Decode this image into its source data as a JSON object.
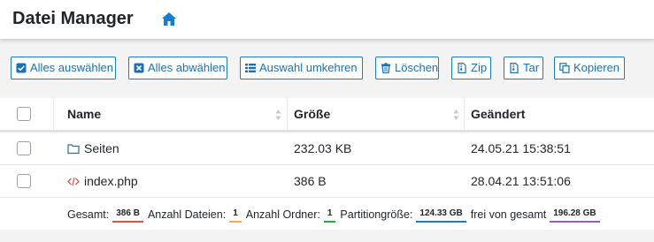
{
  "header": {
    "title": "Datei Manager",
    "home_icon": "home-icon"
  },
  "toolbar": {
    "buttons": [
      {
        "label": "Alles auswählen",
        "icon": "checkbox-checked-icon"
      },
      {
        "label": "Alles abwählen",
        "icon": "checkbox-x-icon"
      },
      {
        "label": "Auswahl umkehren",
        "icon": "list-icon"
      },
      {
        "label": "Löschen",
        "icon": "trash-icon"
      },
      {
        "label": "Zip",
        "icon": "file-archive-icon"
      },
      {
        "label": "Tar",
        "icon": "file-archive-icon"
      },
      {
        "label": "Kopieren",
        "icon": "copy-icon"
      }
    ]
  },
  "table": {
    "columns": [
      "Name",
      "Größe",
      "Geändert"
    ],
    "rows": [
      {
        "name": "Seiten",
        "type": "folder",
        "size": "232.03 KB",
        "modified": "24.05.21 15:38:51"
      },
      {
        "name": "index.php",
        "type": "code",
        "size": "386 B",
        "modified": "28.04.21 13:51:06"
      }
    ],
    "footer": {
      "total_label": "Gesamt:",
      "total_value": "386 B",
      "files_label": "Anzahl Dateien:",
      "files_value": "1",
      "folders_label": "Anzahl Ordner:",
      "folders_value": "1",
      "partition_label": "Partitiongröße:",
      "partition_value": "124.33 GB",
      "free_label": "frei von gesamt",
      "free_value": "196.28 GB"
    }
  },
  "colors": {
    "accent": "#1b7cc9",
    "folder_icon": "#1b6fb5",
    "code_icon": "#d9534f",
    "badge_total": "#e74c3c",
    "badge_files": "#f0ad4e",
    "badge_folders": "#28a745",
    "badge_partition": "#1b7cc9",
    "badge_free": "#9b59b6"
  }
}
